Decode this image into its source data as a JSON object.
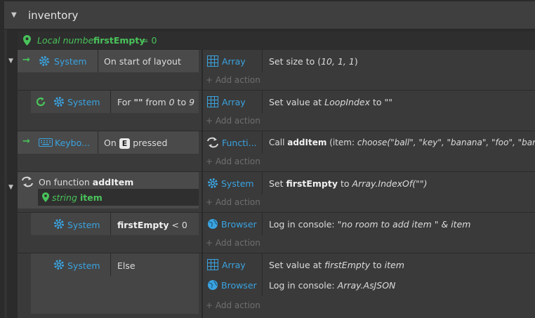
{
  "group": {
    "title": "inventory"
  },
  "local_var": {
    "prefix": "Local number",
    "name": "firstEmpty",
    "suffix": "= 0"
  },
  "events": {
    "e1": {
      "object": "System",
      "condition": "On start of layout",
      "actions": [
        {
          "object": "Array",
          "text_pre": "Set size to (",
          "text_it": "10, 1, 1",
          "text_post": ")"
        }
      ],
      "add_action": "Add action"
    },
    "e2": {
      "object": "System",
      "condition_pre": "For",
      "condition_str": "\"\"",
      "condition_mid": "from",
      "from": "0",
      "to_word": "to",
      "to": "9",
      "actions": [
        {
          "object": "Array",
          "text_pre": "Set value at",
          "text_it": "LoopIndex",
          "text_mid": "to",
          "text_post": "\"\""
        }
      ],
      "add_action": "Add action"
    },
    "e3": {
      "object": "Keybo...",
      "condition_pre": "On",
      "key": "E",
      "condition_post": "pressed",
      "actions": [
        {
          "object": "Functi...",
          "text_pre": "Call",
          "fn": "addItem",
          "args_pre": "(item:",
          "args_it": "choose(\"ball\", \"key\", \"banana\", \"foo\", \"bar\")",
          "args_post": ")"
        }
      ],
      "add_action": "Add action"
    },
    "e4": {
      "condition_pre": "On function",
      "fn": "addItem",
      "param_type": "string",
      "param_name": "item",
      "actions": [
        {
          "object": "System",
          "text_pre": "Set",
          "var": "firstEmpty",
          "text_mid": "to",
          "text_it": "Array.IndexOf(\"\")"
        }
      ],
      "add_action": "Add action"
    },
    "e5": {
      "object": "System",
      "var": "firstEmpty",
      "cmp": "< 0",
      "actions": [
        {
          "object": "Browser",
          "text_pre": "Log in console:",
          "text_it": "\"no room to add item \" & item"
        }
      ],
      "add_action": "Add action"
    },
    "e6": {
      "object": "System",
      "condition": "Else",
      "actions": [
        {
          "object": "Array",
          "text_pre": "Set value at",
          "text_it": "firstEmpty",
          "text_mid": "to",
          "text_it2": "item"
        },
        {
          "object": "Browser",
          "text_pre": "Log in console:",
          "text_it": "Array.AsJSON"
        }
      ],
      "add_action": "Add action"
    }
  },
  "colors": {
    "bg": "#2b2b2b",
    "header": "#3f3f3f",
    "accent_blue": "#3aa3e0",
    "accent_green": "#49c35a"
  },
  "icons": [
    "collapse-triangle-icon",
    "location-pin-icon",
    "trigger-arrow-icon",
    "gear-icon",
    "grid-icon",
    "loop-icon",
    "keyboard-icon",
    "function-icon",
    "globe-icon",
    "plus-icon"
  ]
}
